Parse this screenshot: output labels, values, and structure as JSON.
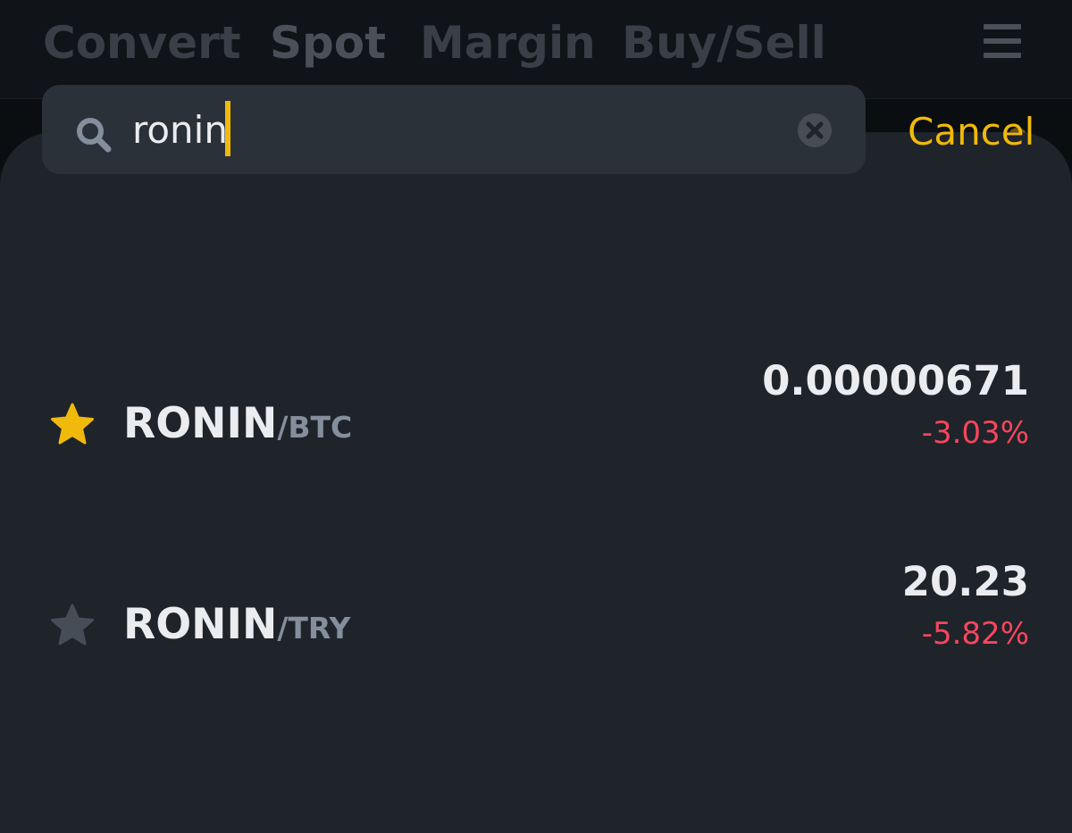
{
  "topbar": {
    "tabs": [
      {
        "label": "Convert",
        "active": false
      },
      {
        "label": "Spot",
        "active": true
      },
      {
        "label": "Margin",
        "active": false
      },
      {
        "label": "Buy/Sell",
        "active": false
      }
    ],
    "menu_icon": "hamburger-menu-icon"
  },
  "search": {
    "value": "ronin",
    "icon": "search-icon",
    "clear_icon": "clear-icon",
    "cancel_label": "Cancel"
  },
  "results": [
    {
      "base": "RONIN",
      "quote": "/BTC",
      "price": "0.00000671",
      "change": "-3.03%",
      "favorite": true
    },
    {
      "base": "RONIN",
      "quote": "/TRY",
      "price": "20.23",
      "change": "-5.82%",
      "favorite": false
    }
  ],
  "colors": {
    "accent": "#f0b90b",
    "negative": "#f6465d",
    "sheet_bg": "#1f232a",
    "search_bg": "#2b3139",
    "muted": "#848e9c",
    "star_inactive": "#474d57"
  }
}
